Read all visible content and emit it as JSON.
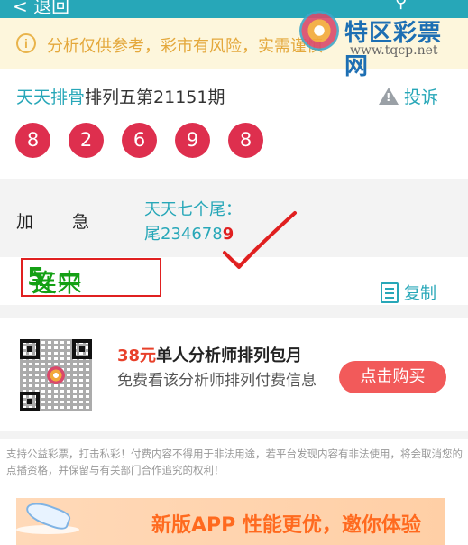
{
  "topbar": {
    "back_label": "< 退回",
    "search_icon": "search-icon",
    "share_icon": "share-icon"
  },
  "watermark": {
    "name": "特区彩票网",
    "url": "www.tqcp.net"
  },
  "notice": {
    "text": "分析仅供参考，彩市有风险，实需谨慎"
  },
  "article": {
    "author": "天天排骨",
    "issue": "排列五第21151期",
    "report_label": "投诉",
    "numbers": [
      "8",
      "2",
      "6",
      "9",
      "8"
    ]
  },
  "tip": {
    "label_1": "加",
    "label_2": "急",
    "line_1": "天天七个尾：",
    "line_2_prefix": "尾234678",
    "line_2_highlight": "9"
  },
  "stamp": {
    "prefix": "又来",
    "count": "5",
    "suffix": "连中"
  },
  "copy_label": "复制",
  "promo": {
    "price": "38元",
    "title": "单人分析师排列包月",
    "desc": "免费看该分析师排列付费信息",
    "buy_label": "点击购买"
  },
  "disclaimer": "支持公益彩票，打击私彩！付费内容不得用于非法用途，若平台发现内容有非法使用，将会取消您的点播资格，并保留与有关部门合作追究的权利！",
  "banner": {
    "text": "新版APP 性能更优，邀你体验"
  },
  "colors": {
    "accent": "#27a7b8",
    "ball": "#de2f4e",
    "notice_text": "#e4a83c",
    "buy": "#f25a5a",
    "stamp_green": "#14a014"
  }
}
